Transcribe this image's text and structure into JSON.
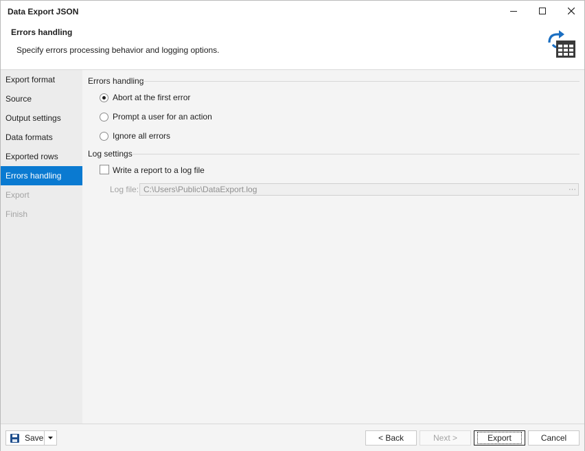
{
  "window": {
    "title": "Data Export JSON"
  },
  "header": {
    "title": "Errors handling",
    "subtitle": "Specify errors processing behavior and logging options.",
    "icon": "export-table-icon"
  },
  "sidebar": {
    "items": [
      {
        "label": "Export format",
        "state": "normal"
      },
      {
        "label": "Source",
        "state": "normal"
      },
      {
        "label": "Output settings",
        "state": "normal"
      },
      {
        "label": "Data formats",
        "state": "normal"
      },
      {
        "label": "Exported rows",
        "state": "normal"
      },
      {
        "label": "Errors handling",
        "state": "active"
      },
      {
        "label": "Export",
        "state": "disabled"
      },
      {
        "label": "Finish",
        "state": "disabled"
      }
    ]
  },
  "errors_group": {
    "label": "Errors handling",
    "options": [
      {
        "label": "Abort at the first error",
        "checked": true
      },
      {
        "label": "Prompt a user for an action",
        "checked": false
      },
      {
        "label": "Ignore all errors",
        "checked": false
      }
    ]
  },
  "log_group": {
    "label": "Log settings",
    "write_report_label": "Write a report to a log file",
    "write_report_checked": false,
    "log_file_label": "Log file:",
    "log_file_value": "C:\\Users\\Public\\DataExport.log",
    "browse_label": "···"
  },
  "footer": {
    "save_label": "Save",
    "back_label": "< Back",
    "next_label": "Next >",
    "export_label": "Export",
    "cancel_label": "Cancel"
  },
  "colors": {
    "accent": "#0a7ad1",
    "icon_blue": "#1b6fc2",
    "icon_dark": "#3a3a3a"
  }
}
